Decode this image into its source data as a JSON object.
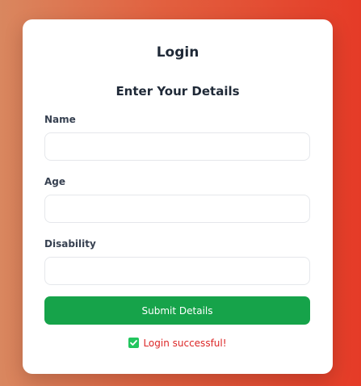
{
  "form": {
    "title": "Login",
    "subtitle": "Enter Your Details",
    "fields": [
      {
        "label": "Name",
        "value": "",
        "placeholder": ""
      },
      {
        "label": "Age",
        "value": "",
        "placeholder": ""
      },
      {
        "label": "Disability",
        "value": "",
        "placeholder": ""
      }
    ],
    "submit_label": "Submit Details",
    "status_message": "Login successful!"
  },
  "colors": {
    "submit_button": "#16a34a",
    "status_text": "#dc2626",
    "check_icon": "#22c55e"
  },
  "icons": {
    "status": "check-icon"
  }
}
